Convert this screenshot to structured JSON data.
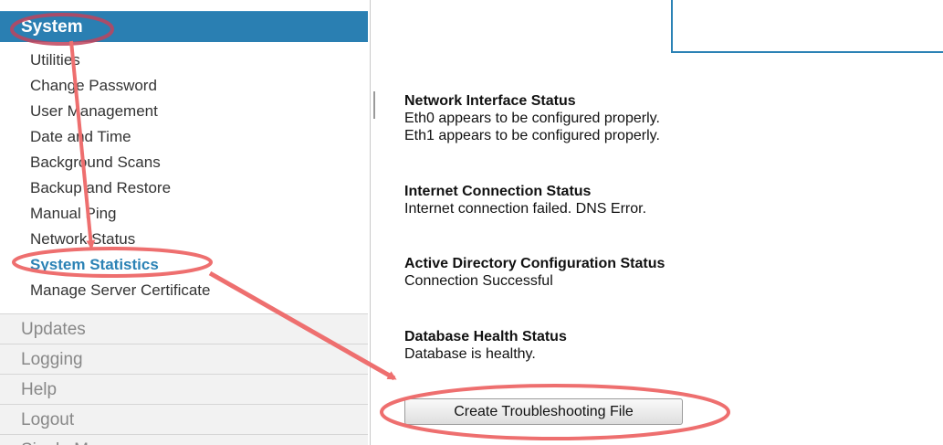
{
  "sidebar": {
    "header": "System",
    "items": [
      {
        "label": "Utilities"
      },
      {
        "label": "Change Password"
      },
      {
        "label": "User Management"
      },
      {
        "label": "Date and Time"
      },
      {
        "label": "Background Scans"
      },
      {
        "label": "Backup and Restore"
      },
      {
        "label": "Manual Ping"
      },
      {
        "label": "Network Status"
      },
      {
        "label": "System Statistics",
        "active": true
      },
      {
        "label": "Manage Server Certificate"
      }
    ],
    "sections": [
      "Updates",
      "Logging",
      "Help",
      "Logout",
      "Single Mo"
    ]
  },
  "status": {
    "network": {
      "title": "Network Interface Status",
      "lines": [
        "Eth0 appears to be configured properly.",
        "Eth1 appears to be configured properly."
      ]
    },
    "internet": {
      "title": "Internet Connection Status",
      "lines": [
        "Internet connection failed. DNS Error."
      ]
    },
    "active_directory": {
      "title": "Active Directory Configuration Status",
      "lines": [
        "Connection Successful"
      ]
    },
    "database": {
      "title": "Database Health Status",
      "lines": [
        "Database is healthy."
      ]
    }
  },
  "create_button_label": "Create Troubleshooting File",
  "colors": {
    "accent": "#2a7fb2",
    "annotation": "#ee6f6f"
  }
}
